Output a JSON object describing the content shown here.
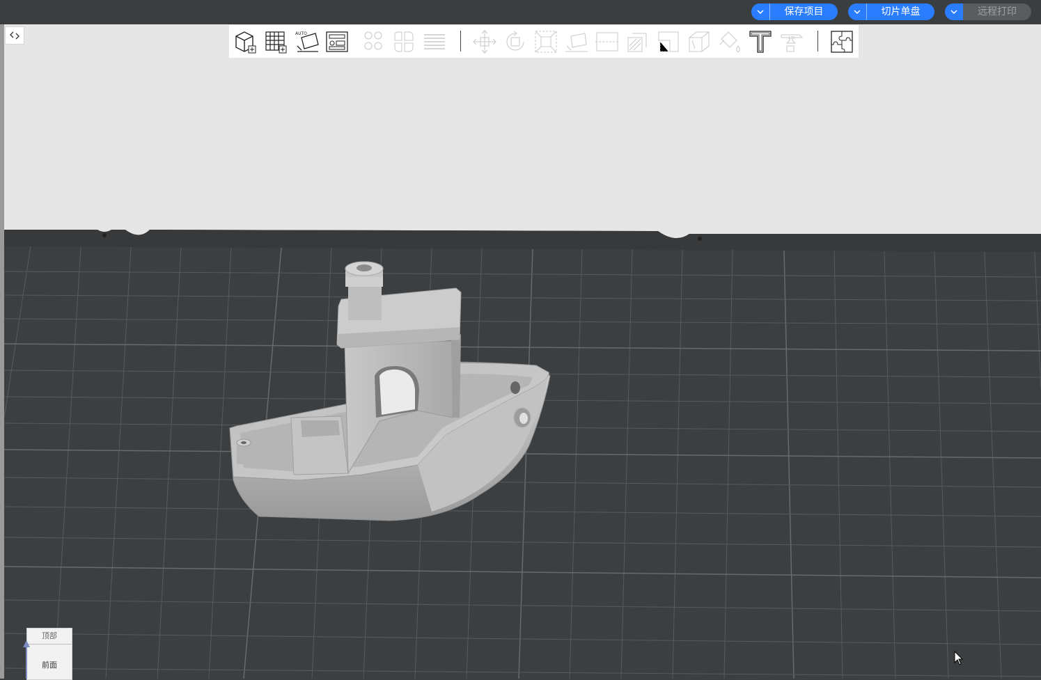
{
  "header": {
    "buttons": [
      {
        "label": "保存项目",
        "state": "enabled"
      },
      {
        "label": "切片单盘",
        "state": "enabled"
      },
      {
        "label": "远程打印",
        "state": "disabled"
      }
    ],
    "accent_color": "#2a7dff"
  },
  "toolbar": {
    "tools": [
      {
        "icon": "add-model-icon",
        "enabled": true
      },
      {
        "icon": "add-plate-icon",
        "enabled": true
      },
      {
        "icon": "auto-orient-icon",
        "enabled": true,
        "label": "AUTO"
      },
      {
        "icon": "arrange-icon",
        "enabled": true
      },
      {
        "icon": "split-objects-icon",
        "enabled": false
      },
      {
        "icon": "split-parts-icon",
        "enabled": false
      },
      {
        "icon": "layers-icon",
        "enabled": false
      },
      {
        "icon": "move-icon",
        "enabled": false
      },
      {
        "icon": "rotate-icon",
        "enabled": false
      },
      {
        "icon": "scale-icon",
        "enabled": false
      },
      {
        "icon": "lay-on-face-icon",
        "enabled": false
      },
      {
        "icon": "cut-icon",
        "enabled": false
      },
      {
        "icon": "support-paint-icon",
        "enabled": false
      },
      {
        "icon": "seam-paint-icon",
        "enabled": false
      },
      {
        "icon": "measure-icon",
        "enabled": false
      },
      {
        "icon": "color-paint-icon",
        "enabled": false
      },
      {
        "icon": "text-icon",
        "enabled": true
      },
      {
        "icon": "assembly-icon",
        "enabled": false
      },
      {
        "icon": "puzzle-icon",
        "enabled": true
      }
    ]
  },
  "viewport": {
    "object": "boat-model",
    "bed_color": "#3c3f41",
    "grid_color": "#5a5e60"
  },
  "viewcube": {
    "top_label": "顶部",
    "front_label": "前面"
  }
}
